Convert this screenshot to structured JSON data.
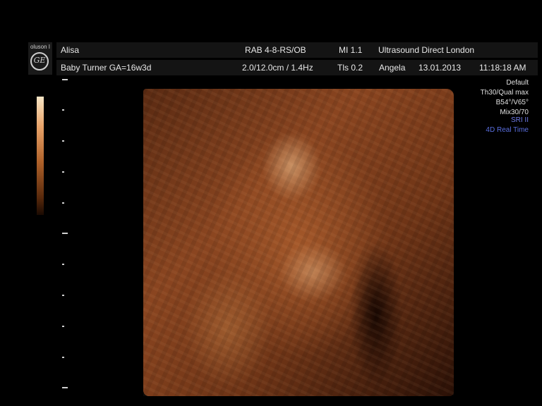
{
  "header": {
    "row1": {
      "patient_name": "Alisa",
      "probe": "RAB 4-8-RS/OB",
      "mi": "MI  1.1",
      "clinic": "Ultrasound Direct London"
    },
    "row2": {
      "patient_info": "Baby Turner  GA=16w3d",
      "depth_freq": "2.0/12.0cm / 1.4Hz",
      "tis": "Tls  0.2",
      "operator": "Angela",
      "date": "13.01.2013",
      "time": "11:18:18 AM"
    }
  },
  "logo": {
    "text": "oluson I",
    "icon": "ge-logo-icon",
    "symbol": "GE"
  },
  "colorbar": {
    "name": "amber-gray-scale-bar"
  },
  "image_params": [
    {
      "text": "Default",
      "color": "#e0e0e0"
    },
    {
      "text": "Th30/Qual max",
      "color": "#e0e0e0"
    },
    {
      "text": "B54°/V65°",
      "color": "#e0e0e0"
    },
    {
      "text": "Mix30/70",
      "color": "#e0e0e0"
    },
    {
      "text": "SRI II",
      "color": "#6f7be8"
    },
    {
      "text": "4D Real Time",
      "color": "#5a6fe0"
    }
  ],
  "colors": {
    "header_bg": "#141414",
    "text": "#e8e8e8",
    "accent_blue": "#5a6fe0",
    "render_tone": "#a4582a"
  }
}
